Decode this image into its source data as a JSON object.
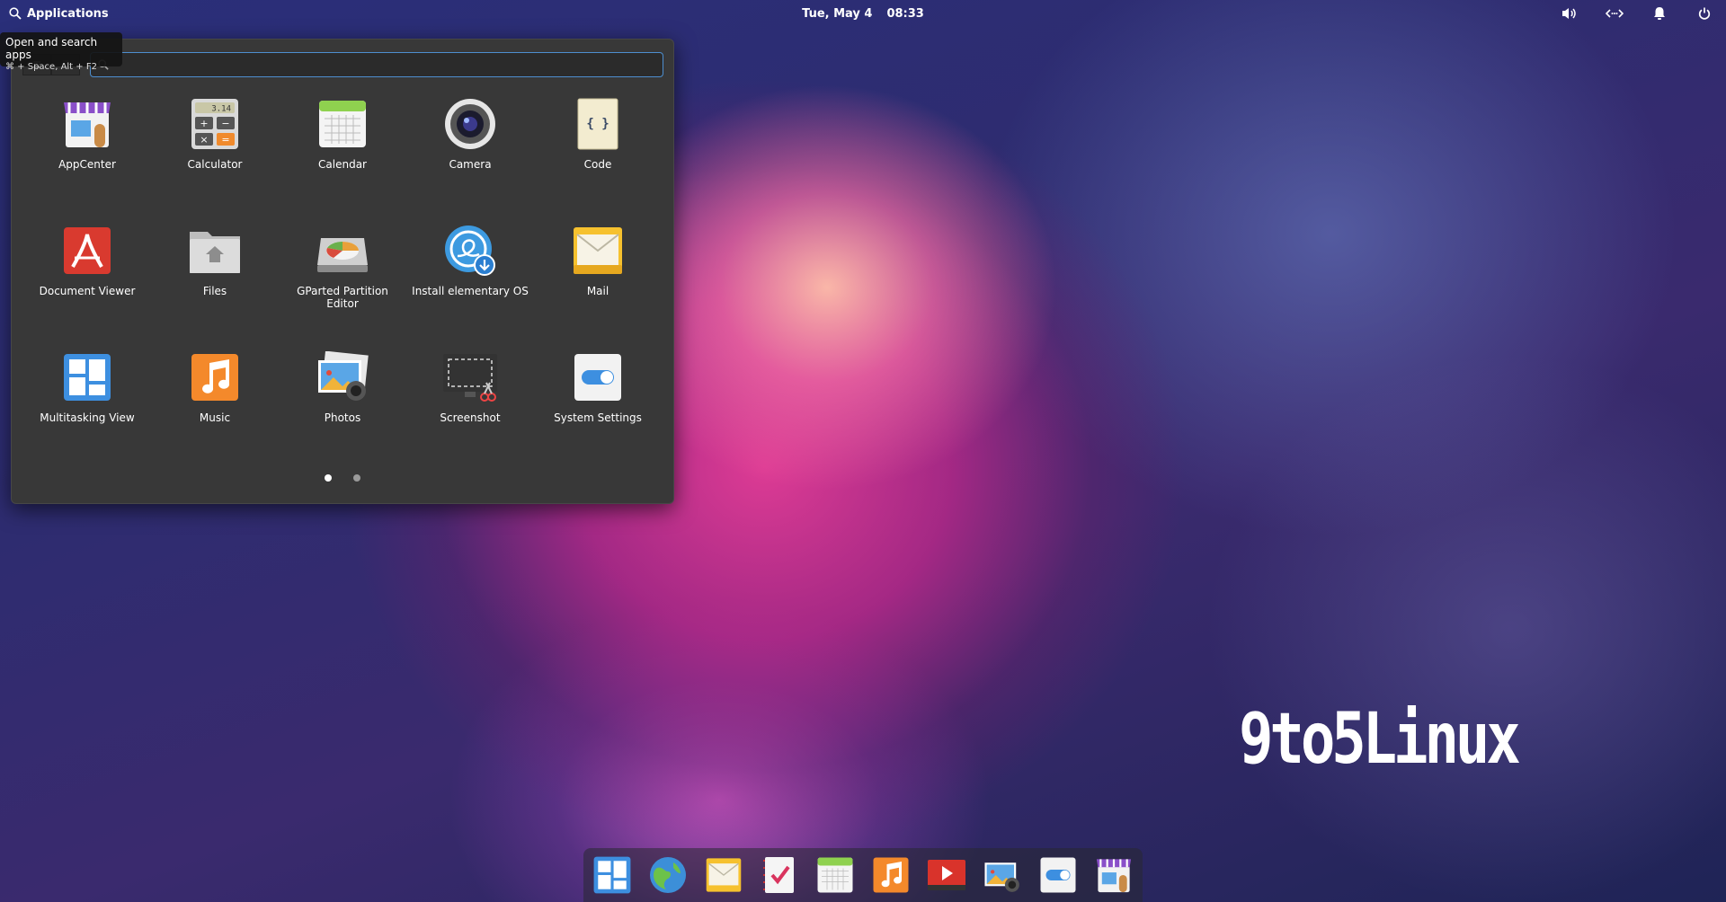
{
  "panel": {
    "applications_label": "Applications",
    "date": "Tue, May  4",
    "time": "08:33",
    "indicators": [
      "volume-icon",
      "network-icon",
      "notifications-icon",
      "power-icon"
    ]
  },
  "tooltip": {
    "title": "Open and search apps",
    "shortcut": "⌘ + Space, Alt + F2"
  },
  "launcher": {
    "search_value": "",
    "apps": [
      {
        "label": "AppCenter",
        "icon": "appcenter-icon"
      },
      {
        "label": "Calculator",
        "icon": "calculator-icon",
        "display": "3.14"
      },
      {
        "label": "Calendar",
        "icon": "calendar-icon"
      },
      {
        "label": "Camera",
        "icon": "camera-icon"
      },
      {
        "label": "Code",
        "icon": "code-icon",
        "glyph": "{ }"
      },
      {
        "label": "Document Viewer",
        "icon": "document-viewer-icon"
      },
      {
        "label": "Files",
        "icon": "files-icon"
      },
      {
        "label": "GParted Partition Editor",
        "icon": "gparted-icon"
      },
      {
        "label": "Install elementary OS",
        "icon": "installer-icon"
      },
      {
        "label": "Mail",
        "icon": "mail-icon"
      },
      {
        "label": "Multitasking View",
        "icon": "multitasking-icon"
      },
      {
        "label": "Music",
        "icon": "music-icon"
      },
      {
        "label": "Photos",
        "icon": "photos-icon"
      },
      {
        "label": "Screenshot",
        "icon": "screenshot-icon"
      },
      {
        "label": "System Settings",
        "icon": "settings-icon"
      }
    ],
    "pages": 2,
    "current_page": 1
  },
  "watermark": "9to5Linux",
  "dock": {
    "items": [
      "multitasking-icon",
      "web-browser-icon",
      "mail-icon",
      "tasks-icon",
      "calendar-icon",
      "music-icon",
      "videos-icon",
      "photos-icon",
      "settings-icon",
      "appcenter-icon"
    ]
  }
}
